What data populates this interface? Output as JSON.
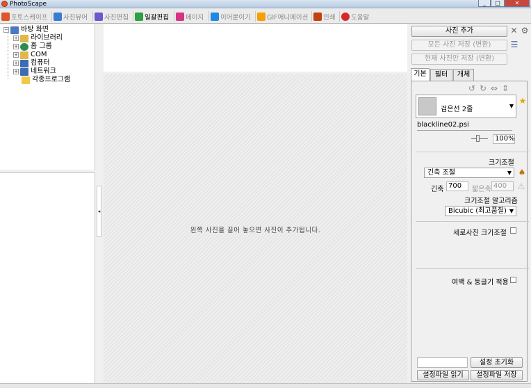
{
  "window": {
    "title": "PhotoScape",
    "minimize": "_",
    "maximize": "□",
    "close": "✕"
  },
  "tabs": [
    {
      "label": "포토스케이프",
      "icon": "photoscape-icon",
      "color": "#e0542a",
      "active": false
    },
    {
      "label": "사진뷰어",
      "icon": "viewer-icon",
      "color": "#3a7bd5",
      "active": false
    },
    {
      "label": "사진편집",
      "icon": "editor-icon",
      "color": "#6a5acd",
      "active": false
    },
    {
      "label": "일괄편집",
      "icon": "batch-editor-icon",
      "color": "#2f9e44",
      "active": true
    },
    {
      "label": "페이지",
      "icon": "page-icon",
      "color": "#d63384",
      "active": false
    },
    {
      "label": "이어붙이기",
      "icon": "combine-icon",
      "color": "#1e88e5",
      "active": false
    },
    {
      "label": "GIF애니메이션",
      "icon": "gif-icon",
      "color": "#f59f00",
      "active": false
    },
    {
      "label": "인쇄",
      "icon": "print-icon",
      "color": "#c2410c",
      "active": false
    },
    {
      "label": "도움말",
      "icon": "help-icon",
      "color": "#d62828",
      "active": false
    }
  ],
  "tree": [
    {
      "label": "바탕 화면",
      "icon": "desktop-icon",
      "color": "#4a78c2"
    },
    {
      "label": "라이브러리",
      "icon": "library-icon",
      "color": "#e0b84a"
    },
    {
      "label": "홈 그룹",
      "icon": "homegroup-icon",
      "color": "#2e8b57"
    },
    {
      "label": "COM",
      "icon": "user-folder-icon",
      "color": "#e0b84a"
    },
    {
      "label": "컴퓨터",
      "icon": "computer-icon",
      "color": "#3d6cb3"
    },
    {
      "label": "네트워크",
      "icon": "network-icon",
      "color": "#3d6cb3"
    },
    {
      "label": "각종프로그램",
      "icon": "folder-icon",
      "color": "#f0c94a"
    }
  ],
  "canvas_hint": "왼쪽 사진을 끌어 놓으면 사진이 추가됩니다.",
  "right": {
    "add_photo": "사진 추가",
    "save_all": "모든 사진 저장 (변환)",
    "save_current": "현재 사진만 저장 (변환)",
    "tabs": [
      "기본",
      "필터",
      "개체"
    ],
    "frame_select": "검은선 2줄",
    "frame_file": "blackline02.psi",
    "opacity": "100%",
    "resize_title": "크기조절",
    "resize_mode": "긴축 조절",
    "long_label": "긴축",
    "long_value": "700",
    "short_label": "짧은축",
    "short_value": "400",
    "algo_title": "크기조절 알고리즘",
    "algo_value": "Bicubic (최고품질)",
    "portrait_resize": "세로사진 크기조절",
    "margin_round": "여백 & 둥글기 적용",
    "reset_settings": "설정 초기화",
    "load_settings": "설정파일 읽기",
    "save_settings": "설정파일 저장"
  },
  "colors": {
    "active_tab_text": "#000000",
    "inactive_tab_text": "#8a8a8a"
  }
}
